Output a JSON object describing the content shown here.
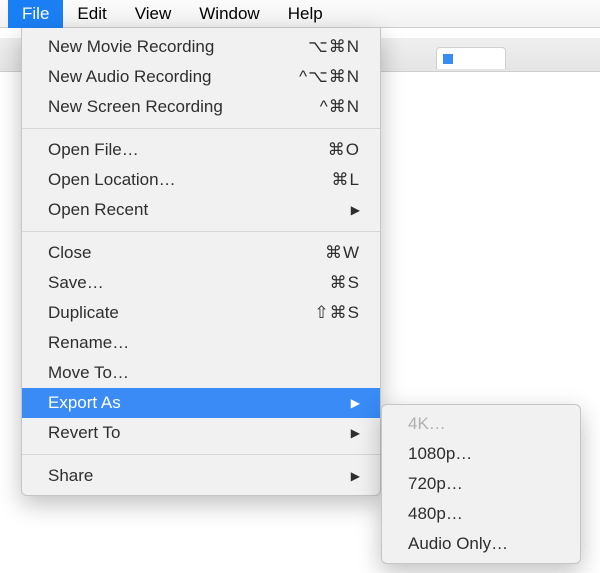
{
  "menubar": {
    "items": [
      "File",
      "Edit",
      "View",
      "Window",
      "Help"
    ],
    "activeIndex": 0
  },
  "dropdown": {
    "groups": [
      [
        {
          "label": "New Movie Recording",
          "shortcut": "⌥⌘N",
          "submenu": false
        },
        {
          "label": "New Audio Recording",
          "shortcut": "^⌥⌘N",
          "submenu": false
        },
        {
          "label": "New Screen Recording",
          "shortcut": "^⌘N",
          "submenu": false
        }
      ],
      [
        {
          "label": "Open File…",
          "shortcut": "⌘O",
          "submenu": false
        },
        {
          "label": "Open Location…",
          "shortcut": "⌘L",
          "submenu": false
        },
        {
          "label": "Open Recent",
          "shortcut": "",
          "submenu": true
        }
      ],
      [
        {
          "label": "Close",
          "shortcut": "⌘W",
          "submenu": false
        },
        {
          "label": "Save…",
          "shortcut": "⌘S",
          "submenu": false
        },
        {
          "label": "Duplicate",
          "shortcut": "⇧⌘S",
          "submenu": false
        },
        {
          "label": "Rename…",
          "shortcut": "",
          "submenu": false
        },
        {
          "label": "Move To…",
          "shortcut": "",
          "submenu": false
        },
        {
          "label": "Export As",
          "shortcut": "",
          "submenu": true,
          "highlight": true
        },
        {
          "label": "Revert To",
          "shortcut": "",
          "submenu": true
        }
      ],
      [
        {
          "label": "Share",
          "shortcut": "",
          "submenu": true
        }
      ]
    ]
  },
  "submenu": {
    "items": [
      {
        "label": "4K…",
        "disabled": true
      },
      {
        "label": "1080p…",
        "disabled": false
      },
      {
        "label": "720p…",
        "disabled": false
      },
      {
        "label": "480p…",
        "disabled": false
      },
      {
        "label": "Audio Only…",
        "disabled": false
      }
    ]
  }
}
